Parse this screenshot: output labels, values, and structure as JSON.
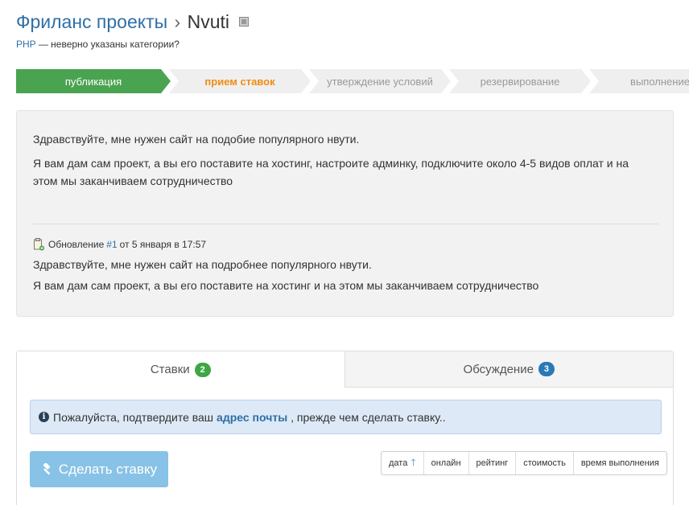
{
  "header": {
    "category": "Фриланс проекты",
    "separator": "›",
    "project": "Nvuti"
  },
  "subtitle": {
    "tag": "PHP",
    "text": "— неверно указаны категории?"
  },
  "stages": [
    {
      "label": "публикация",
      "state": "done"
    },
    {
      "label": "прием ставок",
      "state": "current"
    },
    {
      "label": "утверждение условий",
      "state": "pending"
    },
    {
      "label": "резервирование",
      "state": "pending"
    },
    {
      "label": "выполнение",
      "state": "pending"
    }
  ],
  "description": {
    "line1": "Здравствуйте, мне нужен сайт на подобие популярного нвути.",
    "line2": "Я вам дам сам проект, а вы его поставите на хостинг, настроите админку, подключите около 4-5 видов оплат и на этом мы заканчиваем сотрудничество"
  },
  "update": {
    "prefix": "Обновление",
    "number": "#1",
    "date": "от 5 января в 17:57",
    "line1": "Здравствуйте, мне нужен сайт на подробнее популярного нвути.",
    "line2": "Я вам дам сам проект, а вы его поставите на хостинг и на этом мы заканчиваем сотрудничество"
  },
  "tabs": {
    "bids": {
      "label": "Ставки",
      "count": "2"
    },
    "discussion": {
      "label": "Обсуждение",
      "count": "3"
    }
  },
  "notice": {
    "before": "Пожалуйста, подтвердите ваш",
    "link": "адрес почты",
    "after": ", прежде чем сделать ставку.."
  },
  "bid_button": {
    "label": "Сделать ставку"
  },
  "sort": {
    "date": "дата",
    "online": "онлайн",
    "rating": "рейтинг",
    "cost": "стоимость",
    "time": "время выполнения"
  },
  "colors": {
    "accent": "#2f6fa5",
    "stage_done": "#4aa350",
    "stage_current": "#f08c13",
    "badge_green": "#3fa644",
    "badge_blue": "#2979b5"
  }
}
